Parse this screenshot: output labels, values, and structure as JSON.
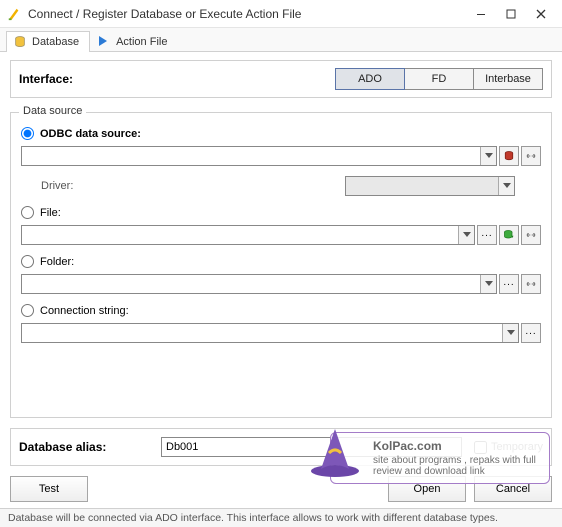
{
  "window": {
    "title": "Connect / Register Database or Execute Action File"
  },
  "tabs": {
    "database": "Database",
    "action_file": "Action File"
  },
  "interface": {
    "label": "Interface:",
    "options": {
      "ado": "ADO",
      "fd": "FD",
      "interbase": "Interbase"
    }
  },
  "datasource": {
    "legend": "Data source",
    "odbc": {
      "label": "ODBC data source:",
      "value": ""
    },
    "driver": {
      "label": "Driver:",
      "value": ""
    },
    "file": {
      "label": "File:",
      "value": ""
    },
    "folder": {
      "label": "Folder:",
      "value": ""
    },
    "connstr": {
      "label": "Connection string:",
      "value": ""
    }
  },
  "alias": {
    "label": "Database alias:",
    "value": "Db001",
    "temporary": "Temporary"
  },
  "buttons": {
    "test": "Test",
    "open": "Open",
    "cancel": "Cancel"
  },
  "status": "Database will be connected via ADO interface. This interface allows to work with different database types.",
  "watermark": {
    "site": "KolPac.com",
    "line": "site about programs , repaks with full review and download link"
  }
}
